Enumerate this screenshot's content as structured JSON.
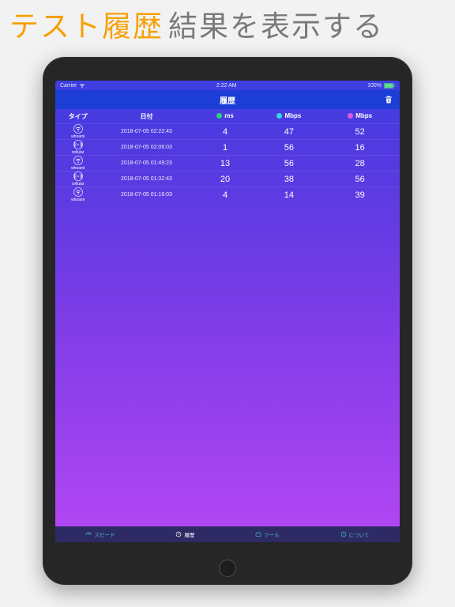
{
  "headline": {
    "part1": "テスト履歴",
    "part2": "結果を表示する"
  },
  "status": {
    "carrier": "Carrier",
    "time": "2:22 AM",
    "battery": "100%"
  },
  "navbar": {
    "title": "履歴"
  },
  "columns": {
    "type": "タイプ",
    "date": "日付",
    "ms": "ms",
    "down": "Mbps",
    "up": "Mbps"
  },
  "rows": [
    {
      "net": "wifi",
      "net_label": "whoami",
      "date": "2018-07-05  02:22:43",
      "ms": "4",
      "down": "47",
      "up": "52"
    },
    {
      "net": "cellular",
      "net_label": "cellular",
      "date": "2018-07-05  02:06:03",
      "ms": "1",
      "down": "56",
      "up": "16"
    },
    {
      "net": "wifi",
      "net_label": "whoami",
      "date": "2018-07-05  01:49:23",
      "ms": "13",
      "down": "56",
      "up": "28"
    },
    {
      "net": "cellular",
      "net_label": "cellular",
      "date": "2018-07-05  01:32:43",
      "ms": "20",
      "down": "38",
      "up": "56"
    },
    {
      "net": "wifi",
      "net_label": "whoami",
      "date": "2018-07-05  01:16:03",
      "ms": "4",
      "down": "14",
      "up": "39"
    }
  ],
  "tabs": {
    "speed": "スピード",
    "history": "履歴",
    "tools": "ツール",
    "about": "について"
  }
}
